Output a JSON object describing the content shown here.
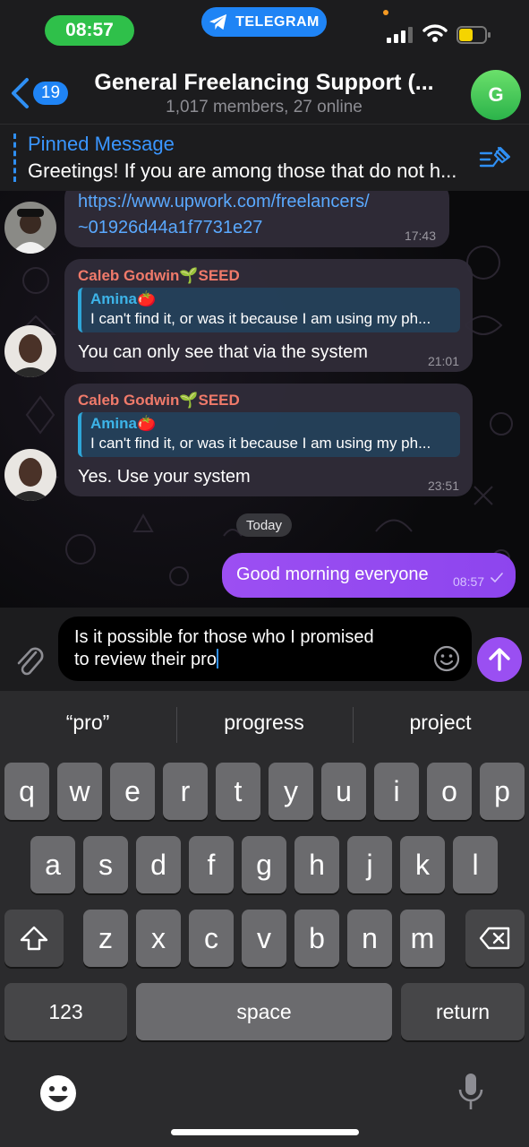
{
  "status_bar": {
    "time": "08:57",
    "app_pill": "TELEGRAM",
    "signal_icon": "cellular-signal-icon",
    "wifi_icon": "wifi-icon",
    "battery_icon": "battery-icon"
  },
  "header": {
    "back_count": "19",
    "title": "General Freelancing Support (...",
    "subtitle": "1,017 members, 27 online",
    "avatar_letter": "G"
  },
  "pinned": {
    "title": "Pinned Message",
    "text": "Greetings! If you are among those that do not h..."
  },
  "messages": [
    {
      "link_line1": "https://www.upwork.com/freelancers/",
      "link_line2": "~01926d44a1f7731e27",
      "time": "17:43"
    },
    {
      "sender": "Caleb Godwin🌱SEED",
      "reply_name": "Amina🍅",
      "reply_text": "I can't find it, or was it because I am using my ph...",
      "text": "You can only see that via the system",
      "time": "21:01"
    },
    {
      "sender": "Caleb Godwin🌱SEED",
      "reply_name": "Amina🍅",
      "reply_text": "I can't find it, or was it because I am using my ph...",
      "text": "Yes. Use your system",
      "time": "23:51"
    }
  ],
  "date_separator": "Today",
  "outgoing": {
    "text": "Good morning everyone",
    "time": "08:57"
  },
  "composer": {
    "line1": "Is it possible for those who I promised",
    "line2": "to review their pro"
  },
  "keyboard": {
    "suggestions": [
      "“pro”",
      "progress",
      "project"
    ],
    "row1": [
      "q",
      "w",
      "e",
      "r",
      "t",
      "y",
      "u",
      "i",
      "o",
      "p"
    ],
    "row2": [
      "a",
      "s",
      "d",
      "f",
      "g",
      "h",
      "j",
      "k",
      "l"
    ],
    "row3": [
      "z",
      "x",
      "c",
      "v",
      "b",
      "n",
      "m"
    ],
    "numbers_key": "123",
    "space_key": "space",
    "return_key": "return"
  },
  "colors": {
    "accent_blue": "#1f84f5",
    "outgoing_bubble": "#9a4ff2",
    "time_pill": "#2fc04a",
    "sender_name": "#f07a6a",
    "reply_name": "#3db4e8"
  }
}
